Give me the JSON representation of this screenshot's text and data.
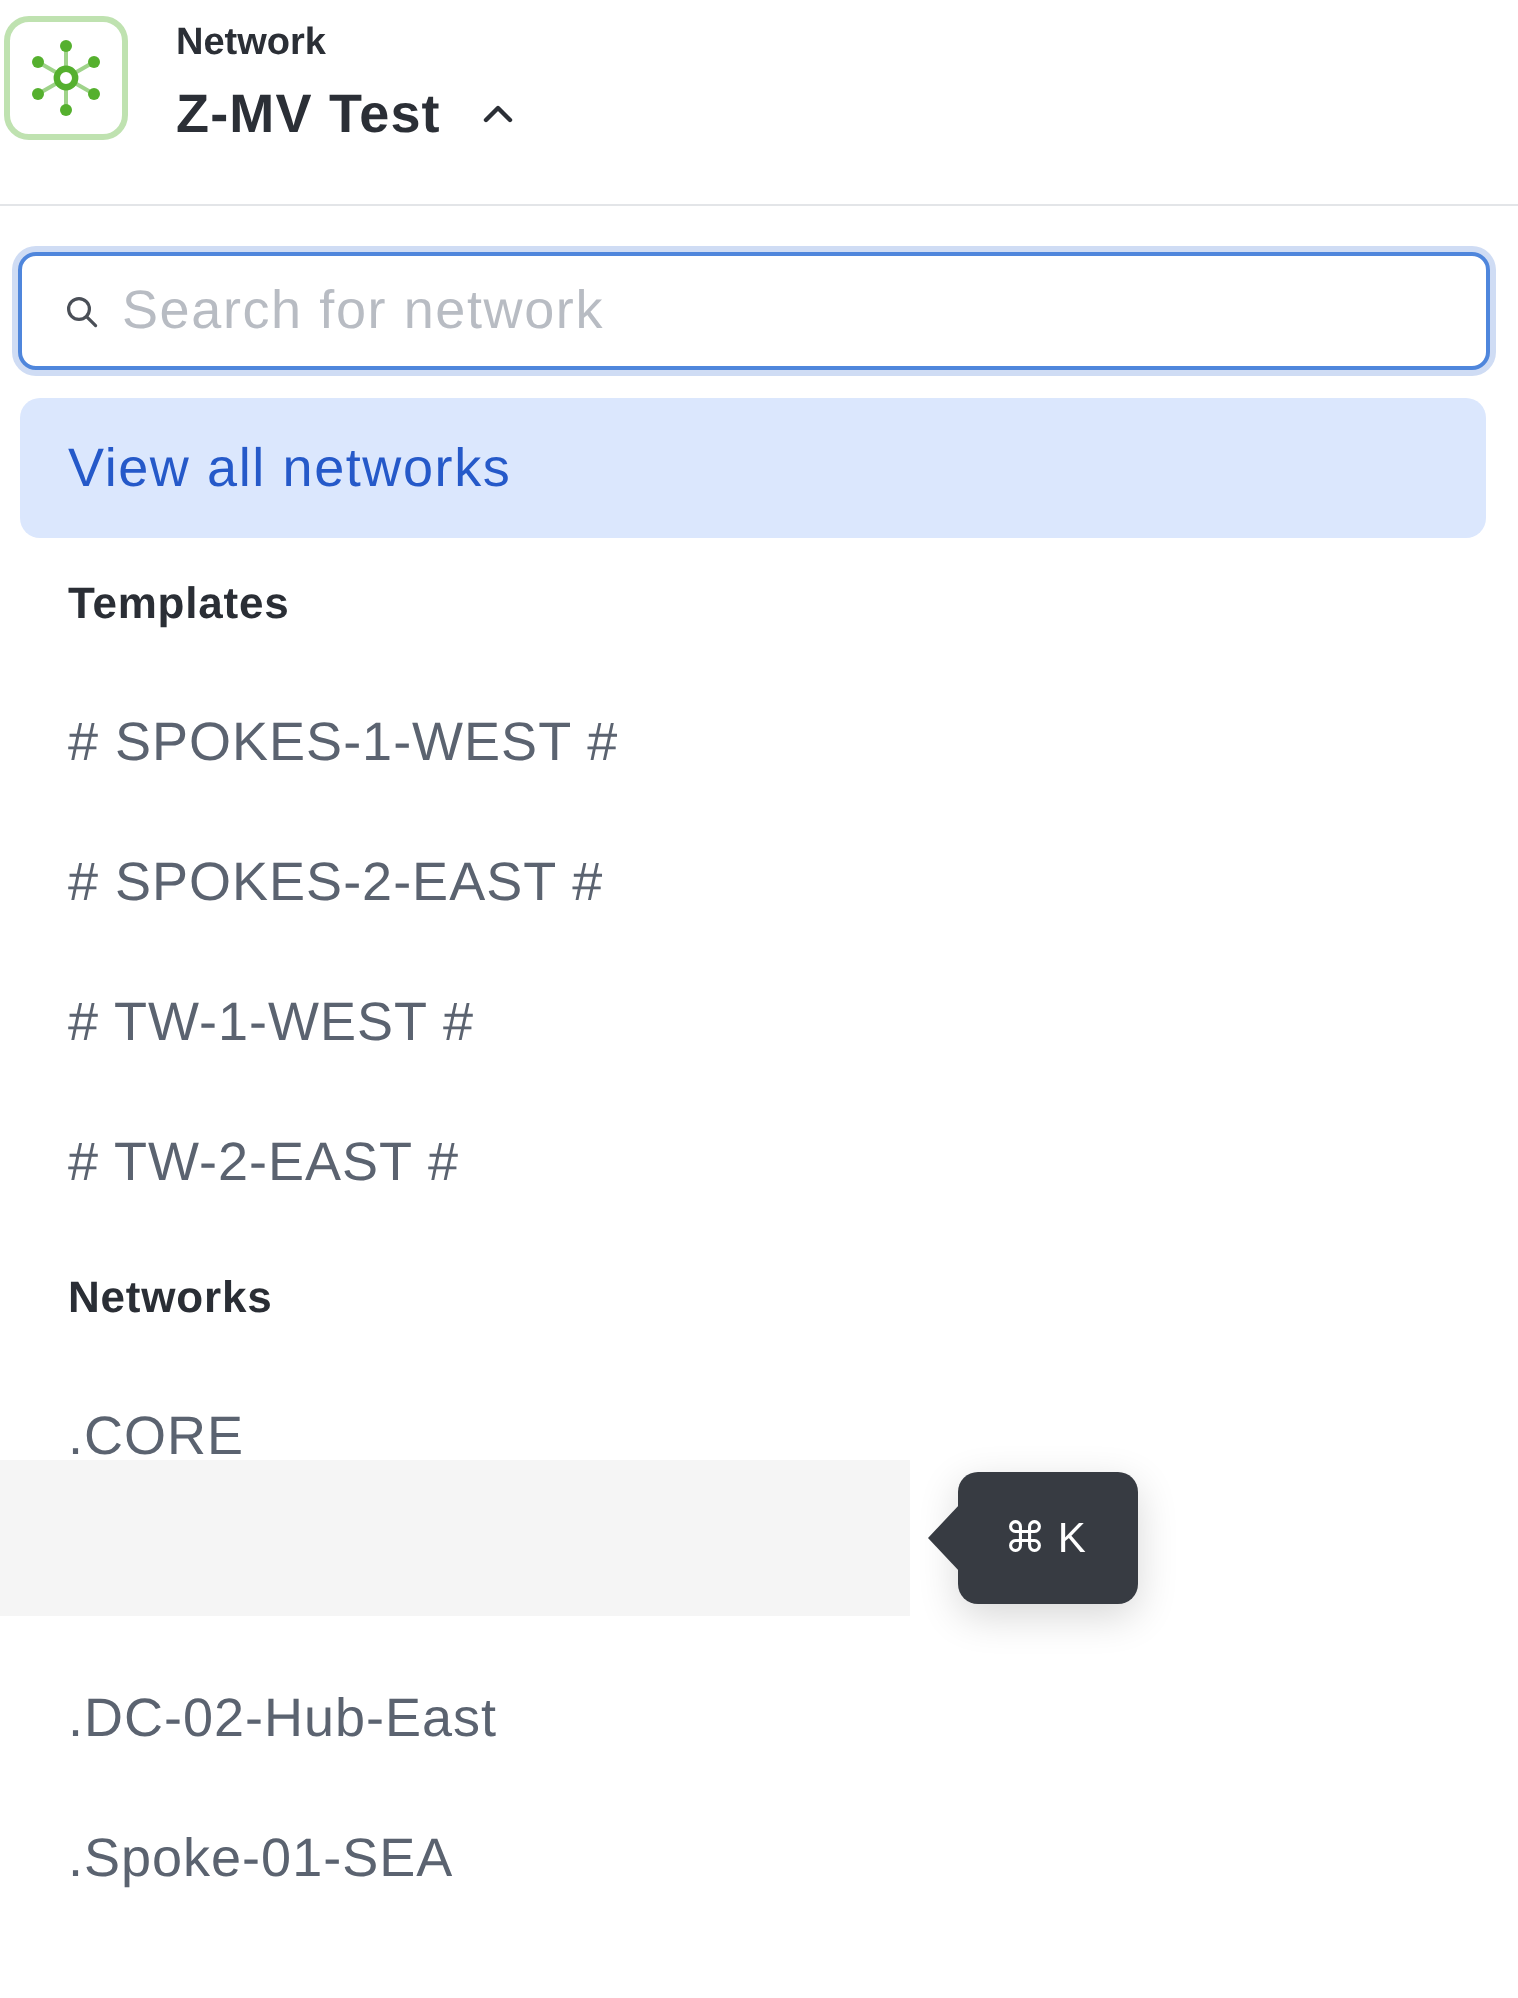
{
  "header": {
    "label": "Network",
    "title": "Z-MV Test",
    "expanded": true
  },
  "search": {
    "placeholder": "Search for network"
  },
  "view_all": {
    "label": "View all networks",
    "selected": true
  },
  "sections": [
    {
      "heading": "Templates",
      "items": [
        {
          "kind": "item",
          "label": "# SPOKES-1-WEST #"
        },
        {
          "kind": "item",
          "label": "# SPOKES-2-EAST #"
        },
        {
          "kind": "item",
          "label": "# TW-1-WEST #"
        },
        {
          "kind": "item",
          "label": "# TW-2-EAST #"
        }
      ]
    },
    {
      "heading": "Networks",
      "items": [
        {
          "kind": "item",
          "label": ".CORE"
        },
        {
          "kind": "hover",
          "tooltip": "⌘ K"
        },
        {
          "kind": "item",
          "label": ".DC-02-Hub-East"
        },
        {
          "kind": "item",
          "label": ".Spoke-01-SEA"
        }
      ]
    }
  ]
}
